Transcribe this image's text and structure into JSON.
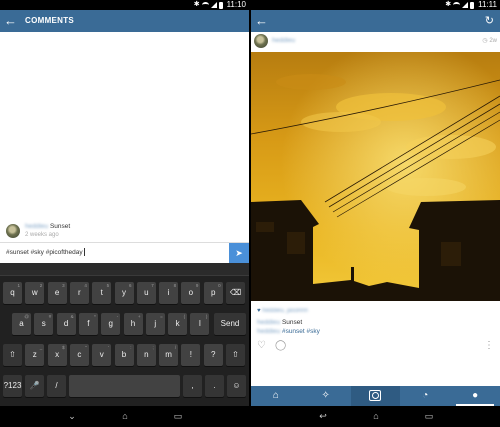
{
  "left_screen": {
    "status": {
      "time": "11:10"
    },
    "appbar": {
      "back_icon": "arrow-left",
      "title": "COMMENTS"
    },
    "comment": {
      "caption": "Sunset",
      "timestamp": "2 weeks ago"
    },
    "input": {
      "value": "#sunset #sky #picoftheday",
      "send_icon": "send-arrow"
    },
    "keyboard": {
      "row1": [
        {
          "k": "q",
          "sub": "1"
        },
        {
          "k": "w",
          "sub": "2"
        },
        {
          "k": "e",
          "sub": "3"
        },
        {
          "k": "r",
          "sub": "4"
        },
        {
          "k": "t",
          "sub": "5"
        },
        {
          "k": "y",
          "sub": "6"
        },
        {
          "k": "u",
          "sub": "7"
        },
        {
          "k": "i",
          "sub": "8"
        },
        {
          "k": "o",
          "sub": "9"
        },
        {
          "k": "p",
          "sub": "0"
        },
        {
          "k": "⌫",
          "sub": ""
        }
      ],
      "row2": [
        {
          "k": "a",
          "sub": "@"
        },
        {
          "k": "s",
          "sub": "#"
        },
        {
          "k": "d",
          "sub": "&"
        },
        {
          "k": "f",
          "sub": "*"
        },
        {
          "k": "g",
          "sub": "-"
        },
        {
          "k": "h",
          "sub": "+"
        },
        {
          "k": "j",
          "sub": "="
        },
        {
          "k": "k",
          "sub": "("
        },
        {
          "k": "l",
          "sub": ")"
        },
        {
          "k": "Send",
          "sub": ""
        }
      ],
      "row3": [
        {
          "k": "⇧",
          "sub": ""
        },
        {
          "k": "z",
          "sub": "_"
        },
        {
          "k": "x",
          "sub": "$"
        },
        {
          "k": "c",
          "sub": "\""
        },
        {
          "k": "v",
          "sub": "'"
        },
        {
          "k": "b",
          "sub": ":"
        },
        {
          "k": "n",
          "sub": ";"
        },
        {
          "k": "m",
          "sub": "/"
        },
        {
          "k": "!",
          "sub": ""
        },
        {
          "k": "?",
          "sub": ""
        },
        {
          "k": "⇧",
          "sub": ""
        }
      ],
      "row4": [
        {
          "k": "?123",
          "sub": ""
        },
        {
          "k": "🎤",
          "sub": ""
        },
        {
          "k": "/",
          "sub": ""
        },
        {
          "k": "",
          "sub": ""
        },
        {
          "k": ",",
          "sub": ""
        },
        {
          "k": ".",
          "sub": ""
        },
        {
          "k": "☺",
          "sub": ""
        }
      ]
    },
    "navbar": {
      "back": "⌄",
      "home": "⌂",
      "recents": "▭"
    }
  },
  "right_screen": {
    "status": {
      "time": "11:11"
    },
    "appbar": {
      "back_icon": "arrow-left",
      "refresh_icon": "refresh"
    },
    "post": {
      "time": "2w",
      "time_icon": "clock",
      "caption": "Sunset",
      "tags": "#sunset #sky",
      "like_icon": "heart",
      "comment_icon": "speech-bubble",
      "more_icon": "vertical-dots"
    },
    "bottom_tabs": [
      {
        "name": "home",
        "icon": "⌂"
      },
      {
        "name": "explore",
        "icon": "✧"
      },
      {
        "name": "camera",
        "icon": "camera"
      },
      {
        "name": "activity",
        "icon": "💬"
      },
      {
        "name": "profile",
        "icon": "👤"
      }
    ],
    "navbar": {
      "back": "↩",
      "home": "⌂",
      "recents": "▭"
    }
  }
}
